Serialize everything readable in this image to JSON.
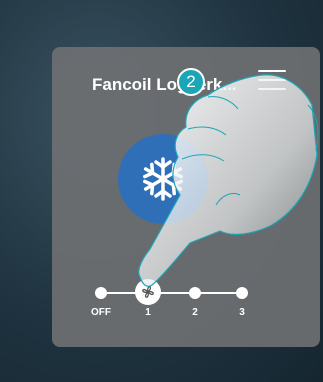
{
  "panel": {
    "title": "Fancoil Logeerk...",
    "menu_icon": "hamburger-menu-icon",
    "mode_icon": "snowflake-icon",
    "mode_color": "#2f6fb7"
  },
  "fan_speed": {
    "icon": "fan-icon",
    "levels": [
      "OFF",
      "1",
      "2",
      "3"
    ],
    "selected": "1"
  },
  "annotation": {
    "step_number": "2",
    "badge_color": "#1aa6b7"
  }
}
